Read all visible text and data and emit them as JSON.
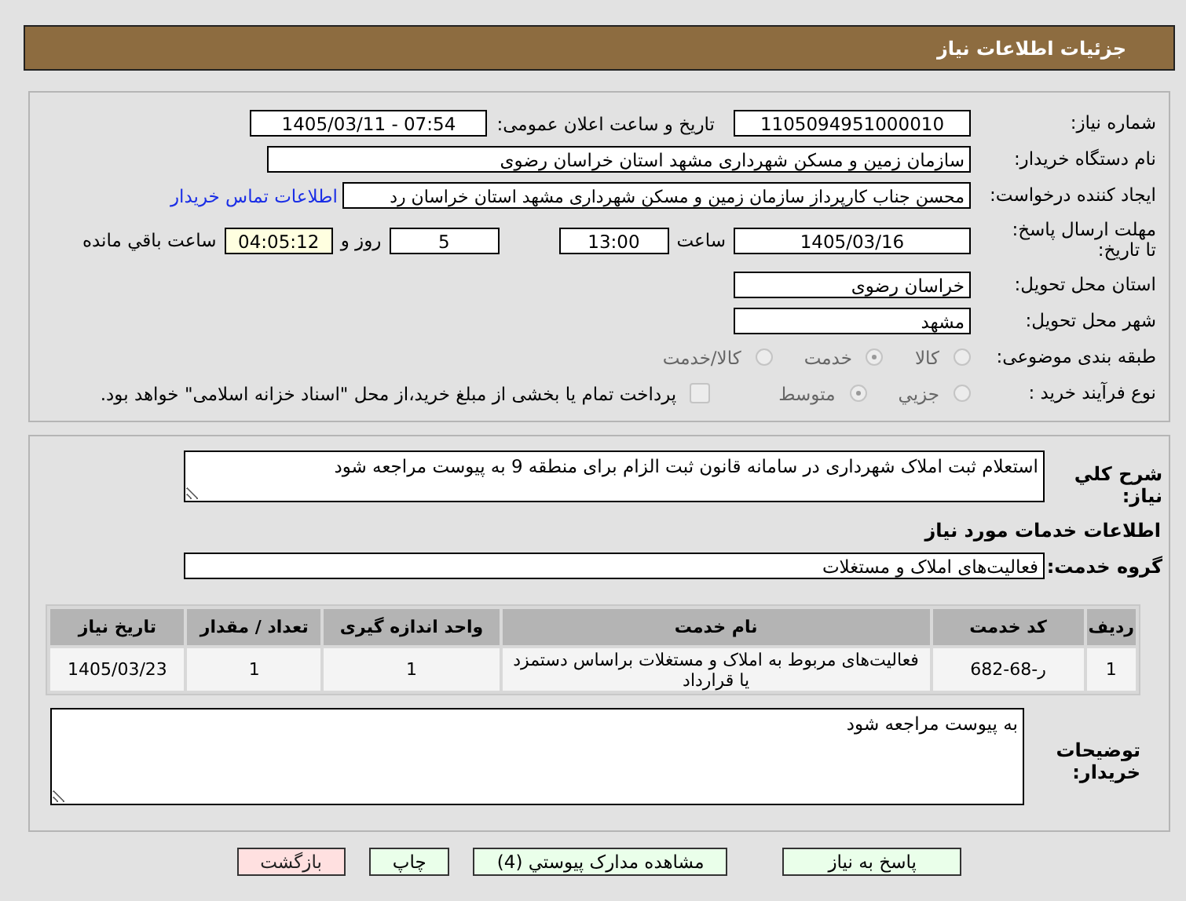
{
  "page_title": "جزئیات اطلاعات نیاز",
  "need_number": {
    "label": "شماره نیاز:",
    "value": "1105094951000010"
  },
  "announce": {
    "label": "تاریخ و ساعت اعلان عمومی:",
    "value": "1405/03/11 - 07:54"
  },
  "buyer_org": {
    "label": "نام دستگاه خریدار:",
    "value": "سازمان زمین و مسکن شهرداری مشهد استان خراسان رضوی"
  },
  "requester": {
    "label": "ایجاد کننده درخواست:",
    "value": "محسن جناب کارپرداز سازمان زمین و مسکن شهرداری مشهد استان خراسان رد",
    "link": "اطلاعات تماس خریدار"
  },
  "deadline": {
    "label": "مهلت ارسال پاسخ: تا تاریخ:",
    "date": "1405/03/16",
    "time_label": "ساعت",
    "time": "13:00",
    "days": "5",
    "days_label": "روز و",
    "remaining": "04:05:12",
    "remaining_label": "ساعت باقي مانده"
  },
  "province": {
    "label": "استان محل تحویل:",
    "value": "خراسان رضوی"
  },
  "city": {
    "label": "شهر محل تحویل:",
    "value": "مشهد"
  },
  "category": {
    "label": "طبقه بندی موضوعی:",
    "options": [
      {
        "label": "کالا",
        "selected": false
      },
      {
        "label": "خدمت",
        "selected": true
      },
      {
        "label": "کالا/خدمت",
        "selected": false
      }
    ]
  },
  "process": {
    "label": "نوع فرآیند خرید :",
    "options": [
      {
        "label": "جزيي",
        "selected": false
      },
      {
        "label": "متوسط",
        "selected": true
      }
    ],
    "payment": {
      "checked": false,
      "text": "پرداخت تمام یا بخشی از مبلغ خرید،از محل \"اسناد خزانه اسلامی\" خواهد بود."
    }
  },
  "description": {
    "label": "شرح کلي نياز:",
    "value": "استعلام ثبت املاک شهرداری در سامانه قانون ثبت الزام برای منطقه 9 به پیوست مراجعه شود"
  },
  "services_heading": "اطلاعات خدمات مورد نیاز",
  "service_group": {
    "label": "گروه خدمت:",
    "value": "فعالیت‌های  املاک و مستغلات"
  },
  "table": {
    "columns": [
      "ردیف",
      "کد خدمت",
      "نام خدمت",
      "واحد اندازه گیری",
      "تعداد / مقدار",
      "تاریخ نیاز"
    ],
    "rows": [
      [
        "1",
        "ر-68-682",
        "فعالیت‌های مربوط به املاک و مستغلات براساس دستمزد یا قرارداد",
        "1",
        "1",
        "1405/03/23"
      ]
    ]
  },
  "buyer_notes": {
    "label": "توضیحات خریدار:",
    "value": "به پیوست مراجعه شود"
  },
  "buttons": [
    {
      "label": "پاسخ به نیاز",
      "kind": "normal"
    },
    {
      "label": "مشاهده مدارک پیوستي (4)",
      "kind": "normal"
    },
    {
      "label": "چاپ",
      "kind": "normal"
    },
    {
      "label": "بازگشت",
      "kind": "back"
    }
  ]
}
